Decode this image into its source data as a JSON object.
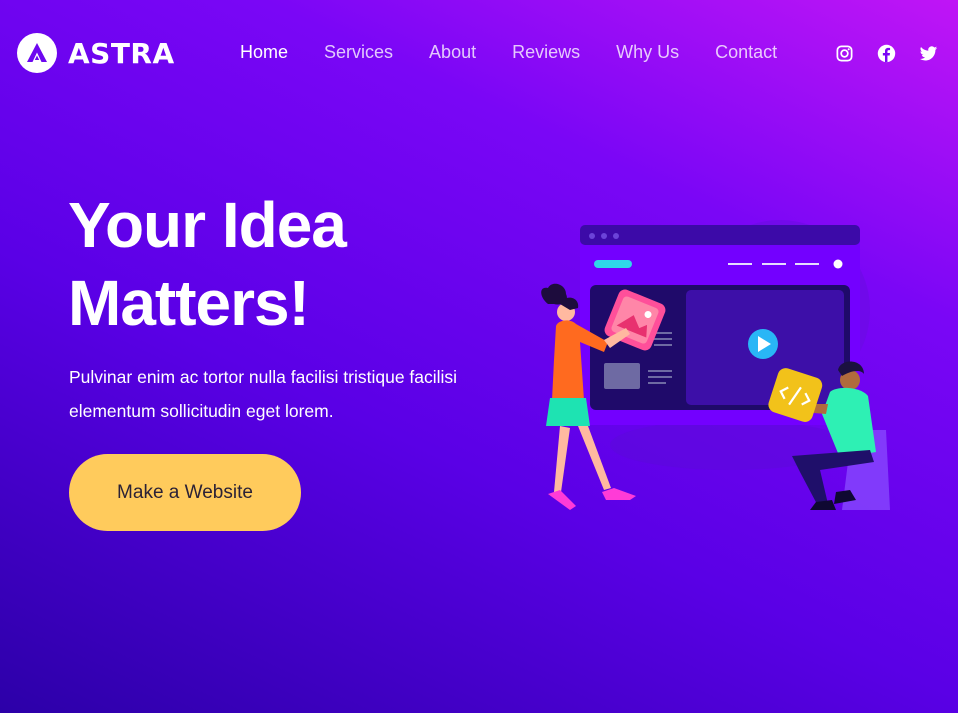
{
  "brand": {
    "name": "ASTRA"
  },
  "nav": {
    "items": [
      {
        "label": "Home",
        "active": true
      },
      {
        "label": "Services",
        "active": false
      },
      {
        "label": "About",
        "active": false
      },
      {
        "label": "Reviews",
        "active": false
      },
      {
        "label": "Why Us",
        "active": false
      },
      {
        "label": "Contact",
        "active": false
      }
    ]
  },
  "socials": [
    "instagram-icon",
    "facebook-icon",
    "twitter-icon"
  ],
  "hero": {
    "headline_line1": "Your Idea",
    "headline_line2": "Matters!",
    "lead": "Pulvinar enim ac tortor nulla facilisi tristique facilisi elementum sollicitudin eget lorem.",
    "cta_label": "Make a Website"
  },
  "colors": {
    "gradient_start": "#c015f6",
    "gradient_mid": "#5a00e6",
    "gradient_end": "#2c00a8",
    "cta": "#ffcb5c",
    "cta_text": "#2b2236"
  }
}
